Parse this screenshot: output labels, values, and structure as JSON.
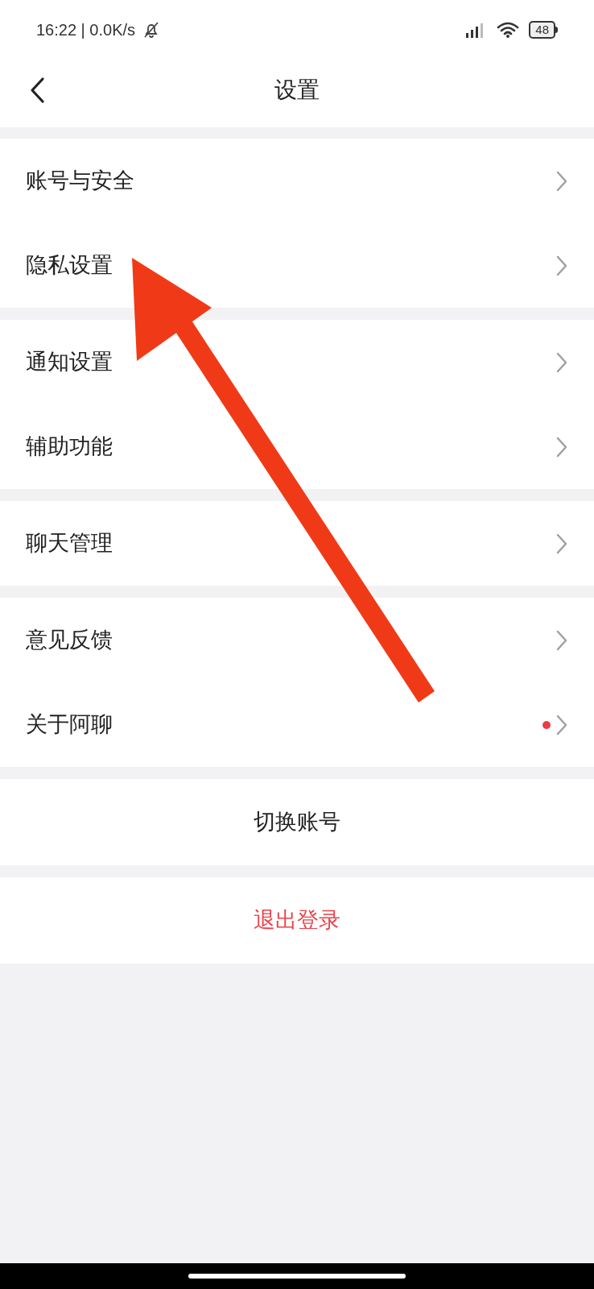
{
  "status_bar": {
    "time": "16:22 | 0.0K/s",
    "battery": "48"
  },
  "header": {
    "title": "设置"
  },
  "groups": [
    {
      "rows": [
        {
          "label": "账号与安全",
          "dot": false
        },
        {
          "label": "隐私设置",
          "dot": false
        }
      ]
    },
    {
      "rows": [
        {
          "label": "通知设置",
          "dot": false
        },
        {
          "label": "辅助功能",
          "dot": false
        }
      ]
    },
    {
      "rows": [
        {
          "label": "聊天管理",
          "dot": false
        }
      ]
    },
    {
      "rows": [
        {
          "label": "意见反馈",
          "dot": false
        },
        {
          "label": "关于阿聊",
          "dot": true
        }
      ]
    }
  ],
  "actions": [
    {
      "label": "切换账号",
      "kind": "normal"
    },
    {
      "label": "退出登录",
      "kind": "danger"
    }
  ]
}
